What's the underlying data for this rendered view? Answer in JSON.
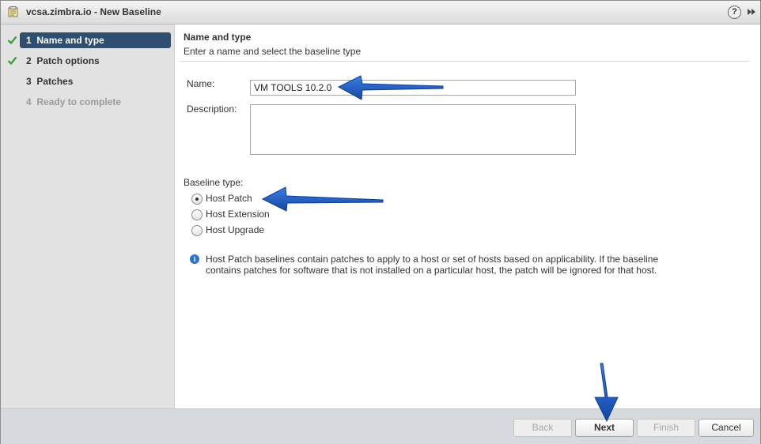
{
  "window": {
    "title": "vcsa.zimbra.io - New Baseline"
  },
  "sidebar": {
    "steps": [
      {
        "number": "1",
        "label": "Name and type",
        "state": "active",
        "completed": true
      },
      {
        "number": "2",
        "label": "Patch options",
        "state": "normal",
        "completed": true
      },
      {
        "number": "3",
        "label": "Patches",
        "state": "normal",
        "completed": false
      },
      {
        "number": "4",
        "label": "Ready to complete",
        "state": "disabled",
        "completed": false
      }
    ]
  },
  "main": {
    "section_title": "Name and type",
    "section_subtitle": "Enter a name and select the baseline type",
    "name_label": "Name:",
    "name_value": "VM TOOLS 10.2.0",
    "description_label": "Description:",
    "description_value": "",
    "baseline_type_label": "Baseline type:",
    "baseline_types": [
      {
        "label": "Host Patch",
        "checked": true
      },
      {
        "label": "Host Extension",
        "checked": false
      },
      {
        "label": "Host Upgrade",
        "checked": false
      }
    ],
    "info_text": "Host Patch baselines contain patches to apply to a host or set of hosts based on applicability. If the baseline contains patches for software that is not installed on a particular host, the patch will be ignored for that host."
  },
  "footer": {
    "back_label": "Back",
    "next_label": "Next",
    "finish_label": "Finish",
    "cancel_label": "Cancel"
  },
  "colors": {
    "active_step_bg": "#2f4e70",
    "check_green": "#3a9a3a",
    "annotation_arrow": "#1a56b8",
    "info_blue": "#2c74c9"
  }
}
